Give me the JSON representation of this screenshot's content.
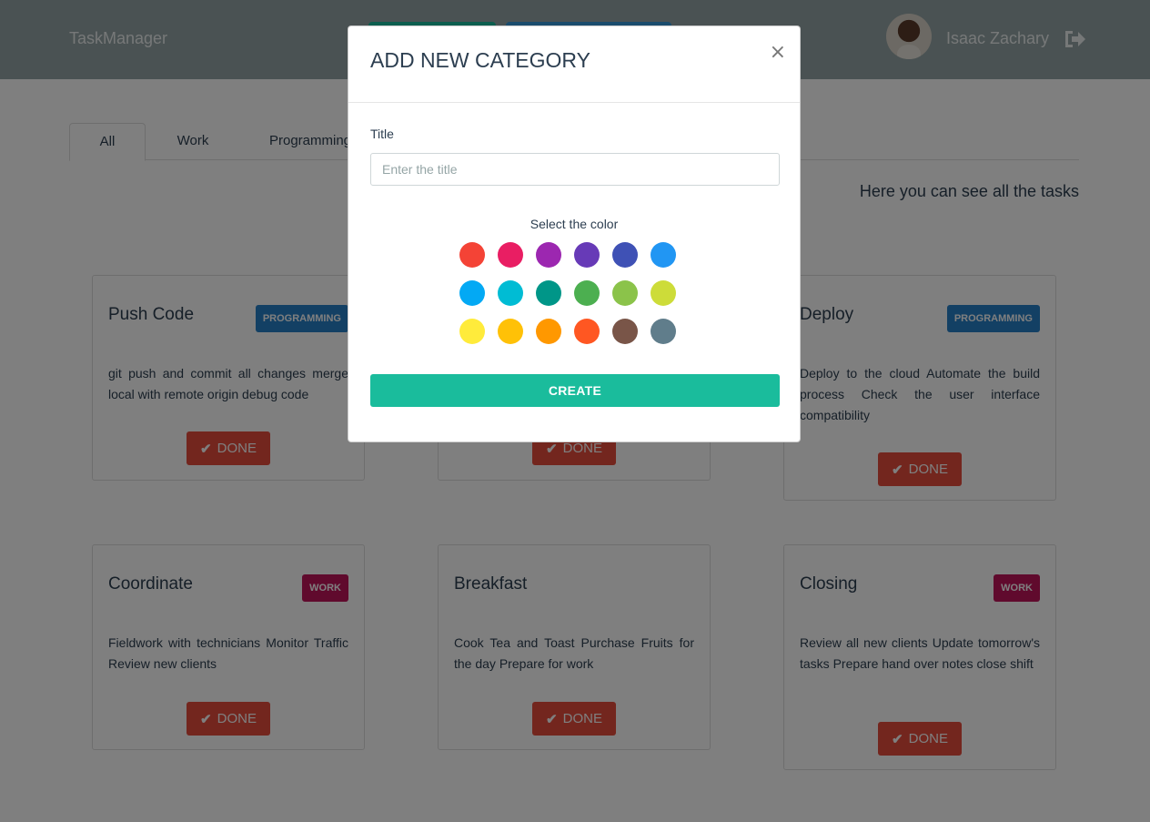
{
  "navbar": {
    "brand": "TaskManager",
    "user_name": "Isaac Zachary"
  },
  "tabs": [
    {
      "label": "All",
      "active": true
    },
    {
      "label": "Work",
      "active": false
    },
    {
      "label": "Programming",
      "active": false
    }
  ],
  "subtitle": "Here you can see all the tasks",
  "cards": [
    {
      "title": "Push Code",
      "badge": "PROGRAMMING",
      "badge_color": "#2780c8",
      "description": "git push and commit all changes merge local with remote origin debug code",
      "button": "DONE"
    },
    {
      "title": "",
      "badge": "",
      "badge_color": "",
      "description": "",
      "button": "DONE"
    },
    {
      "title": "Deploy",
      "badge": "PROGRAMMING",
      "badge_color": "#2780c8",
      "description": "Deploy to the cloud Automate the build process Check the user interface compatibility",
      "button": "DONE"
    },
    {
      "title": "Coordinate",
      "badge": "WORK",
      "badge_color": "#c0155a",
      "description": "Fieldwork with technicians Monitor Traffic Review new clients",
      "button": "DONE"
    },
    {
      "title": "Breakfast",
      "badge": "",
      "badge_color": "",
      "description": "Cook Tea and Toast Purchase Fruits for the day Prepare for work",
      "button": "DONE"
    },
    {
      "title": "Closing",
      "badge": "WORK",
      "badge_color": "#c0155a",
      "description": "Review all new clients Update tomorrow's tasks Prepare hand over notes close shift",
      "button": "DONE"
    }
  ],
  "modal": {
    "title": "ADD NEW CATEGORY",
    "close": "×",
    "field_label": "Title",
    "input_value": "",
    "input_placeholder": "Enter the title",
    "color_label": "Select the color",
    "colors": [
      "#f44336",
      "#e91e63",
      "#9c27b0",
      "#673ab7",
      "#3f51b5",
      "#2196f3",
      "#03a9f4",
      "#00bcd4",
      "#009688",
      "#4caf50",
      "#8bc34a",
      "#cddc39",
      "#ffeb3b",
      "#ffc107",
      "#ff9800",
      "#ff5722",
      "#795548",
      "#607d8b"
    ],
    "create_label": "CREATE"
  },
  "icons": {
    "logout": "logout-icon",
    "check": "check-icon",
    "close": "close-icon"
  }
}
